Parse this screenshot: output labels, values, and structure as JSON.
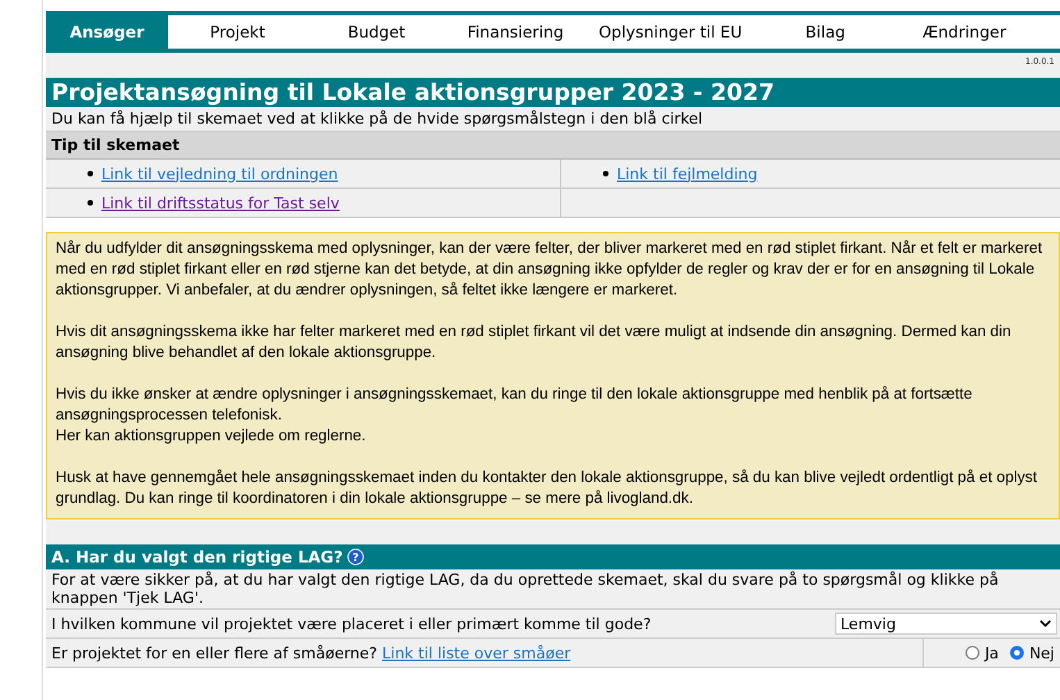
{
  "tabs": [
    {
      "label": "Ansøger",
      "selected": true
    },
    {
      "label": "Projekt",
      "selected": false
    },
    {
      "label": "Budget",
      "selected": false
    },
    {
      "label": "Finansiering",
      "selected": false
    },
    {
      "label": "Oplysninger til EU",
      "selected": false
    },
    {
      "label": "Bilag",
      "selected": false
    },
    {
      "label": "Ændringer",
      "selected": false
    }
  ],
  "version": "1.0.0.1",
  "title": "Projektansøgning til Lokale aktionsgrupper 2023 - 2027",
  "subtitle": "Du kan få hjælp til skemaet ved at klikke på de hvide spørgsmålstegn i den blå cirkel",
  "tips": {
    "title": "Tip til skemaet",
    "rows": [
      [
        {
          "text": "Link til vejledning til ordningen",
          "visited": false
        },
        {
          "text": "Link til fejlmelding",
          "visited": false
        }
      ],
      [
        {
          "text": "Link til driftsstatus for Tast selv",
          "visited": true
        }
      ]
    ]
  },
  "notice": [
    [
      "Når du udfylder dit ansøgningsskema med oplysninger, kan der være felter, der bliver markeret med en rød stiplet firkant. Når et felt er markeret med en rød stiplet firkant eller en rød stjerne kan det betyde, at din ansøgning ikke opfylder de regler og krav der er for en ansøgning til Lokale aktionsgrupper. Vi anbefaler, at du ændrer oplysningen, så feltet ikke længere er markeret."
    ],
    [
      "Hvis dit ansøgningsskema ikke har felter markeret med en rød stiplet firkant vil det være muligt at indsende din ansøgning. Dermed kan din ansøgning blive behandlet af den lokale aktionsgruppe."
    ],
    [
      "Hvis du ikke ønsker at ændre oplysninger i ansøgningsskemaet, kan du ringe til den lokale aktionsgruppe med henblik på at fortsætte ansøgningsprocessen telefonisk.",
      "Her kan aktionsgruppen vejlede om reglerne."
    ],
    [
      "Husk at have gennemgået hele ansøgningsskemaet inden du kontakter den lokale aktionsgruppe, så du kan blive vejledt ordentligt på et oplyst grundlag. Du kan ringe til koordinatoren i din lokale aktionsgruppe – se mere på livogland.dk."
    ]
  ],
  "section": {
    "title": "A. Har du valgt den rigtige LAG?",
    "help": "?",
    "intro": "For at være sikker på, at du har valgt den rigtige LAG, da du oprettede skemaet, skal du svare på to spørgsmål og klikke på knappen 'Tjek LAG'.",
    "questions": [
      {
        "kind": "select",
        "label": "I hvilken kommune vil projektet være placeret i eller primært komme til gode?",
        "value": "Lemvig"
      },
      {
        "kind": "radio",
        "label": "Er projektet for en eller flere af småøerne?",
        "link": "Link til liste over småøer",
        "options": [
          {
            "label": "Ja",
            "selected": false
          },
          {
            "label": "Nej",
            "selected": true
          }
        ]
      }
    ]
  }
}
